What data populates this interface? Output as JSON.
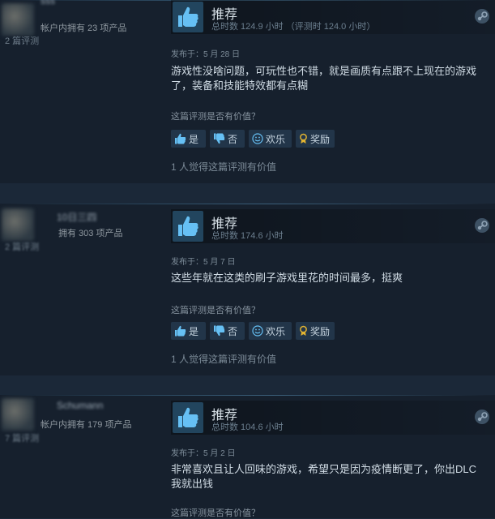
{
  "reviews": [
    {
      "author_name": "sss",
      "products_owned": "帐户内拥有 23 项产品",
      "reviews_written": "2 篇评测",
      "recommendation": "推荐",
      "hours": "总时数 124.9 小时 （评测时 124.0 小时）",
      "posted": "发布于：5 月 28 日",
      "content": "游戏性没啥问题，可玩性也不错，就是画质有点跟不上现在的游戏了，装备和技能特效都有点糊",
      "helpful_question": "这篇评测是否有价值？",
      "buttons": {
        "yes": "是",
        "no": "否",
        "funny": "欢乐",
        "award": "奖励"
      },
      "helpful_count": "1 人觉得这篇评测有价值"
    },
    {
      "author_name": "10日三四",
      "products_owned": "拥有 303 项产品",
      "reviews_written": "2 篇评测",
      "recommendation": "推荐",
      "hours": "总时数 174.6 小时",
      "posted": "发布于：5 月 7 日",
      "content": "这些年就在这类的刷子游戏里花的时间最多，挺爽",
      "helpful_question": "这篇评测是否有价值？",
      "buttons": {
        "yes": "是",
        "no": "否",
        "funny": "欢乐",
        "award": "奖励"
      },
      "helpful_count": "1 人觉得这篇评测有价值"
    },
    {
      "author_name": "Schumann",
      "products_owned": "帐户内拥有 179 项产品",
      "reviews_written": "7 篇评测",
      "recommendation": "推荐",
      "hours": "总时数 104.6 小时",
      "posted": "发布于：5 月 2 日",
      "content": "非常喜欢且让人回味的游戏，希望只是因为疫情断更了，你出DLC我就出钱",
      "helpful_question": "这篇评测是否有价值？"
    }
  ],
  "icons": {
    "thumb": "thumbs-up-icon",
    "steam": "steam-logo-icon",
    "yes": "thumbs-up-small-icon",
    "no": "thumbs-down-small-icon",
    "funny": "smiley-icon",
    "award": "award-ribbon-icon"
  },
  "colors": {
    "page_bg": "#1b2838",
    "review_bg": "#16202d",
    "thumb_blue": "#66c0f4",
    "award_gold": "#e3b431",
    "button_bg": "#223549"
  }
}
